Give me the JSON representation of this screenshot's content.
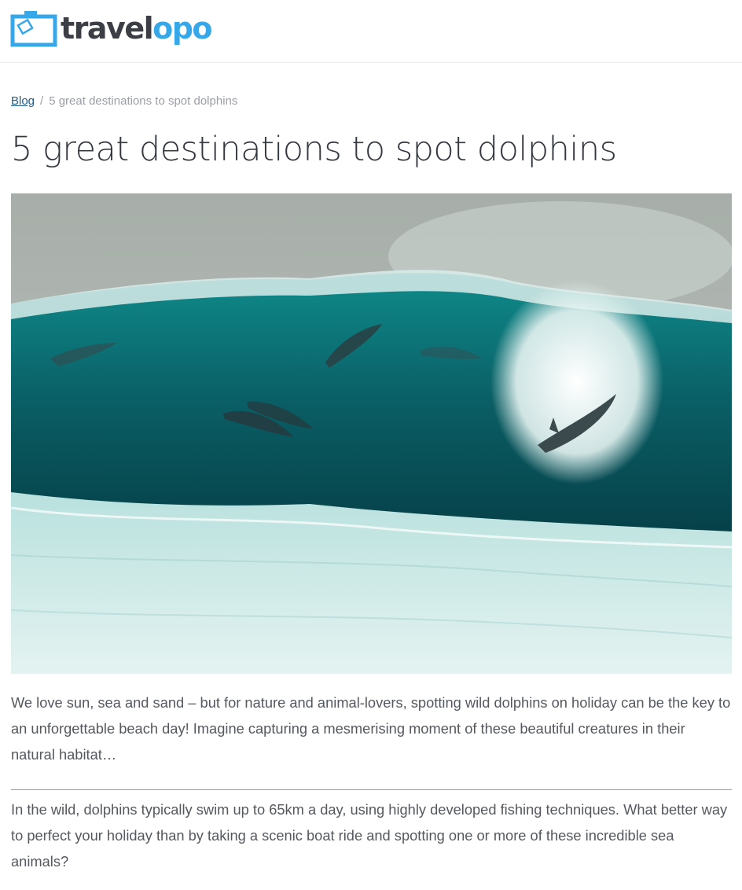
{
  "header": {
    "logo_text_dark": "travel",
    "logo_text_blue": "opo",
    "brand_blue": "#36a8e9",
    "brand_dark": "#3b3f45"
  },
  "breadcrumb": {
    "blog_label": "Blog",
    "separator": "/",
    "current": "5 great destinations to spot dolphins"
  },
  "article": {
    "title": "5 great destinations to spot dolphins",
    "hero_image": "wave-with-dolphins-photo",
    "intro": "We love sun, sea and sand – but for nature and animal-lovers, spotting wild dolphins on holiday can be the key to an unforgettable beach day! Imagine capturing a mesmerising moment of these beautiful creatures in their natural habitat…",
    "paragraph_2": "In the wild, dolphins typically swim up to 65km a day, using highly developed fishing techniques. What better way to perfect your holiday than by taking a scenic boat ride and spotting one or more of these incredible sea animals?"
  },
  "colors": {
    "text": "#54595f",
    "title": "#33383e",
    "link": "#1f5d8c",
    "muted": "#9aa0a6"
  }
}
